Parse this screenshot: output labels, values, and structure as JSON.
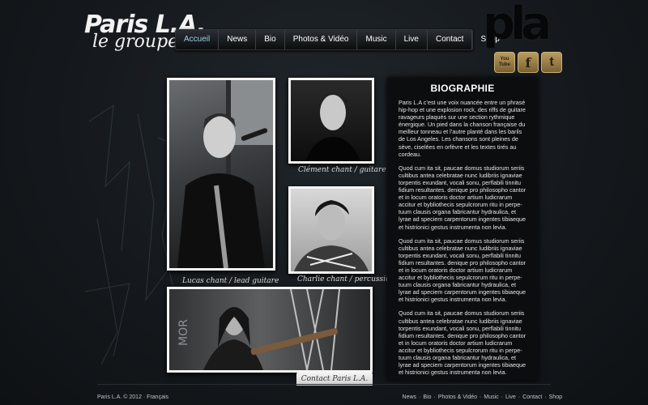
{
  "logo": {
    "line1": "Paris L.A.",
    "line2": "le groupe",
    "mark": "pla"
  },
  "nav": {
    "items": [
      "Accueil",
      "News",
      "Bio",
      "Photos & Vidéo",
      "Music",
      "Live",
      "Contact",
      "Shop"
    ],
    "active": "Accueil"
  },
  "social": [
    {
      "icon": "youtube-icon",
      "label": "You Tube"
    },
    {
      "icon": "facebook-icon",
      "label": "f"
    },
    {
      "icon": "twitter-icon",
      "label": "t"
    }
  ],
  "photos": {
    "lucas": "Lucas chant / lead guitare",
    "clement": "Clément chant / guitare",
    "charlie": "Charlie chant / percussions"
  },
  "bio": {
    "title": "BIOGRAPHIE",
    "paragraphs": [
      "Paris L.A c’est une voix nuancée entre un phrasé hip-hop et une explosion rock, des riffs de guitare ravageurs plaqués sur une section rythmique énergique. Un pied dans la chanson française du meilleur tonneau et l’autre planté dans les barils de Los Angeles. Les chansons sont pleines de sève, ciselées en orfèvre et les textes tirés au cordeau.",
      "Quod cum ita sit, paucae domus studiorum seriis cultibus antea celebratae nunc ludibriis ignaviae torpentis exundant, vocali sonu, perflabili tinnitu fidium resultantes. denique pro philosopho cantor et in locum oratoris doctor artium ludicrarum accitur et bybliothecis sepulcrorum ritu in perpe-tuum clausis organa fabricantur hydraulica, et lyrae ad speciem carpentorum ingentes tibiaeque et histrionici gestus instrumenta non levia.",
      "Quod cum ita sit, paucae domus studiorum seriis cultibus antea celebratae nunc ludibriis ignaviae torpentis exundant, vocali sonu, perflabili tinnitu fidium resultantes. denique pro philosopho cantor et in locum oratoris doctor artium ludicrarum accitur et bybliothecis sepulcrorum ritu in perpe-tuum clausis organa fabricantur hydraulica, et lyrae ad speciem carpentorum ingentes tibiaeque et histrionici gestus instrumenta non levia.",
      "Quod cum ita sit, paucae domus studiorum seriis cultibus antea celebratae nunc ludibriis ignaviae torpentis exundant, vocali sonu, perflabili tinnitu fidium resultantes. denique pro philosopho cantor et in locum oratoris doctor artium ludicrarum accitur et bybliothecis sepulcrorum ritu in perpe-tuum clausis organa fabricantur hydraulica, et lyrae ad speciem carpentorum ingentes tibiaeque et histrionici gestus instrumenta non levia."
    ]
  },
  "contact_tab": "Contact Paris L.A.",
  "footer": {
    "left": "Paris L.A.  © 2012 · Français",
    "links": [
      "News",
      "Bio",
      "Photos & Vidéo",
      "Music",
      "Live",
      "Contact",
      "Shop"
    ],
    "separator": "·"
  },
  "colors": {
    "background": "#13171b",
    "nav_active": "#9fd1e4",
    "social_gold": "#b89b5f"
  }
}
